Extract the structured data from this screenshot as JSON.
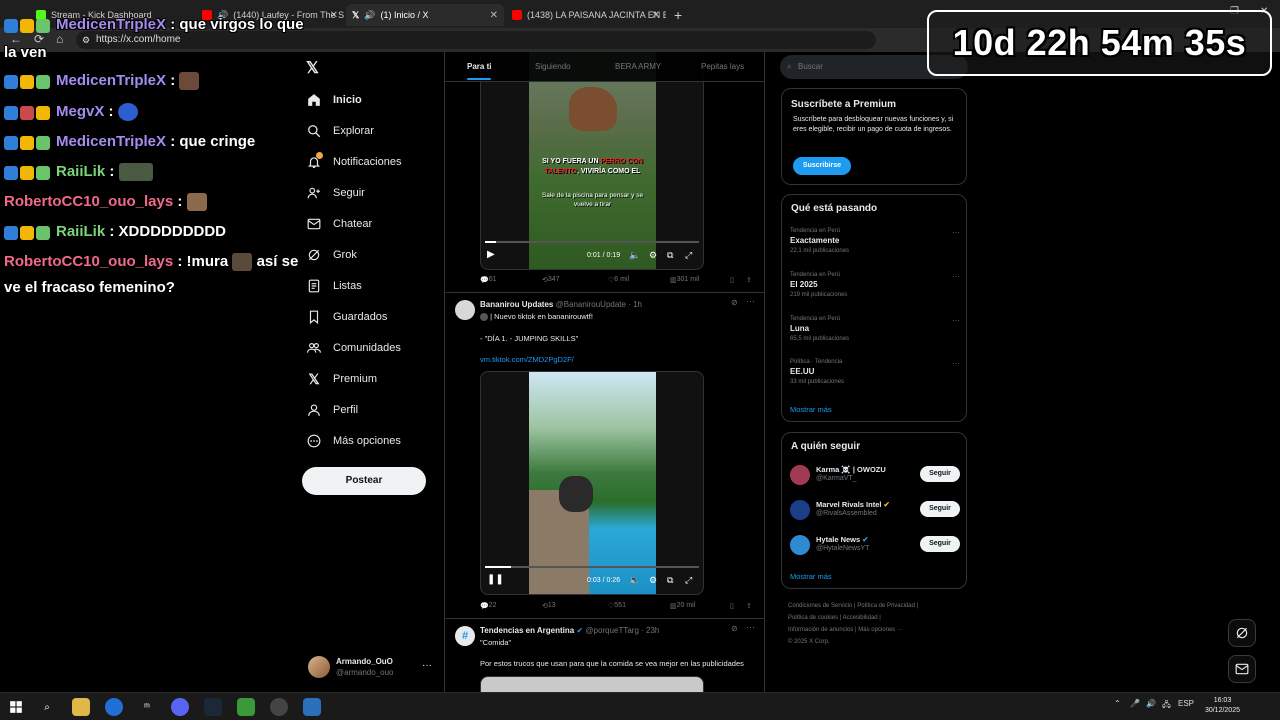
{
  "browser": {
    "tabs": [
      {
        "label": "Stream - Kick Dashboard",
        "favicon_color": "#53fc18"
      },
      {
        "label": "(1440) Laufey - From The Sta",
        "favicon_color": "#ff0000"
      },
      {
        "label": "(1) Inicio / X",
        "favicon_color": "#ffffff",
        "active": true
      },
      {
        "label": "(1438) LA PAISANA JACINTA EN B",
        "favicon_color": "#ff0000"
      }
    ],
    "new_tab": "+",
    "url": "https://x.com/home"
  },
  "x": {
    "nav": [
      {
        "label": "Inicio",
        "icon": "home-icon",
        "active": true
      },
      {
        "label": "Explorar",
        "icon": "search-icon"
      },
      {
        "label": "Notificaciones",
        "icon": "bell-icon"
      },
      {
        "label": "Seguir",
        "icon": "add-person-icon"
      },
      {
        "label": "Chatear",
        "icon": "mail-icon"
      },
      {
        "label": "Grok",
        "icon": "grok-icon"
      },
      {
        "label": "Listas",
        "icon": "list-icon"
      },
      {
        "label": "Guardados",
        "icon": "bookmark-icon"
      },
      {
        "label": "Comunidades",
        "icon": "people-icon"
      },
      {
        "label": "Premium",
        "icon": "x-logo-icon"
      },
      {
        "label": "Perfil",
        "icon": "person-icon"
      },
      {
        "label": "Más opciones",
        "icon": "more-circle-icon"
      }
    ],
    "post_button": "Postear",
    "account": {
      "name": "Armando_OuO",
      "handle": "@armando_ouo"
    },
    "feed_tabs": [
      "Para ti",
      "Siguiendo",
      "BERA ARMY",
      "Pepitas lays"
    ],
    "tweet1": {
      "video_text_white1": "SI YO FUERA UN ",
      "video_text_red": "PERRO CON TALENTO",
      "video_text_white2": ", VIVIRÍA COMO EL",
      "video_caption": "Sale de la piscina para pensar y se vuelve a tirar",
      "time": "0:01 / 0:19",
      "replies": "61",
      "reposts": "347",
      "likes": "6 mil",
      "views": "301 mil",
      "progress": 0.05
    },
    "tweet2": {
      "name": "Bananirou Updates",
      "handle": "@BananirouUpdate",
      "time": "· 1h",
      "line1": "| Nuevo tiktok en bananirouwtf!",
      "line2": "- \"DÍA 1. - JUMPING SKILLS\"",
      "link": "vm.tiktok.com/ZMD2PgD2F/",
      "video_time": "0:03 / 0:26",
      "replies": "22",
      "reposts": "13",
      "likes": "551",
      "views": "20 mil",
      "progress": 0.12
    },
    "tweet3": {
      "name": "Tendencias en Argentina",
      "handle": "@porqueTTarg",
      "time": "· 23h",
      "line1": "\"Comida\"",
      "line2": "Por estos trucos que usan para que la comida se vea mejor en las publicidades"
    },
    "search_placeholder": "Buscar",
    "premium": {
      "title": "Suscríbete a Premium",
      "body": "Suscríbete para desbloquear nuevas funciones y, si eres elegible, recibir un pago de cuota de ingresos.",
      "button": "Suscribirse"
    },
    "trends_title": "Qué está pasando",
    "trends": [
      {
        "context": "Tendencia en Perú",
        "name": "Exactamente",
        "count": "22,1 mil publicaciones"
      },
      {
        "context": "Tendencia en Perú",
        "name": "El 2025",
        "count": "219 mil publicaciones"
      },
      {
        "context": "Tendencia en Perú",
        "name": "Luna",
        "count": "65,5 mil publicaciones"
      },
      {
        "context": "Política · Tendencia",
        "name": "EE.UU",
        "count": "33 mil publicaciones"
      }
    ],
    "show_more": "Mostrar más",
    "follow_title": "A quién seguir",
    "follow": [
      {
        "name": "Karma ☠️ | OWOZU",
        "handle": "@KarmaVT_",
        "color": "#a23a52"
      },
      {
        "name": "Marvel Rivals Intel",
        "handle": "@RivalsAssembled",
        "color": "#1b3e8a"
      },
      {
        "name": "Hytale News",
        "handle": "@HytaleNewsYT",
        "color": "#2f8bd0"
      }
    ],
    "follow_button": "Seguir",
    "footer": [
      "Condiciones de Servicio",
      "Política de Privacidad",
      "Política de cookies",
      "Accesibilidad",
      "Información de anuncios",
      "Más opciones ···",
      "© 2025 X Corp."
    ]
  },
  "overlay": {
    "chat_top_partial": "MedicenTripleX",
    "chat_top_msg": ": que virgos lo que",
    "chat_top_cont": "la ven",
    "chat": [
      {
        "user": "MedicenTripleX",
        "color": "#a58cf0",
        "msg": ":"
      },
      {
        "user": "MegvX",
        "color": "#a58cf0",
        "msg": ":"
      },
      {
        "user": "MedicenTripleX",
        "color": "#a58cf0",
        "msg": ": que cringe"
      },
      {
        "user": "RaiiLik",
        "color": "#7ad47a",
        "msg": ":"
      },
      {
        "user": "RobertoCC10_ouo_lays",
        "color": "#f06a8a",
        "msg": ":"
      },
      {
        "user": "RaiiLik",
        "color": "#7ad47a",
        "msg": ": XDDDDDDDDD"
      },
      {
        "user": "RobertoCC10_ouo_lays",
        "color": "#f06a8a",
        "msg": ": !mura"
      },
      {
        "msg": "así se"
      }
    ],
    "chat_last_line": "ve el fracaso femenino?",
    "timer": "10d 22h 54m 35s"
  },
  "taskbar": {
    "lang": "ESP",
    "time": "16:03",
    "date": "30/12/2025"
  }
}
